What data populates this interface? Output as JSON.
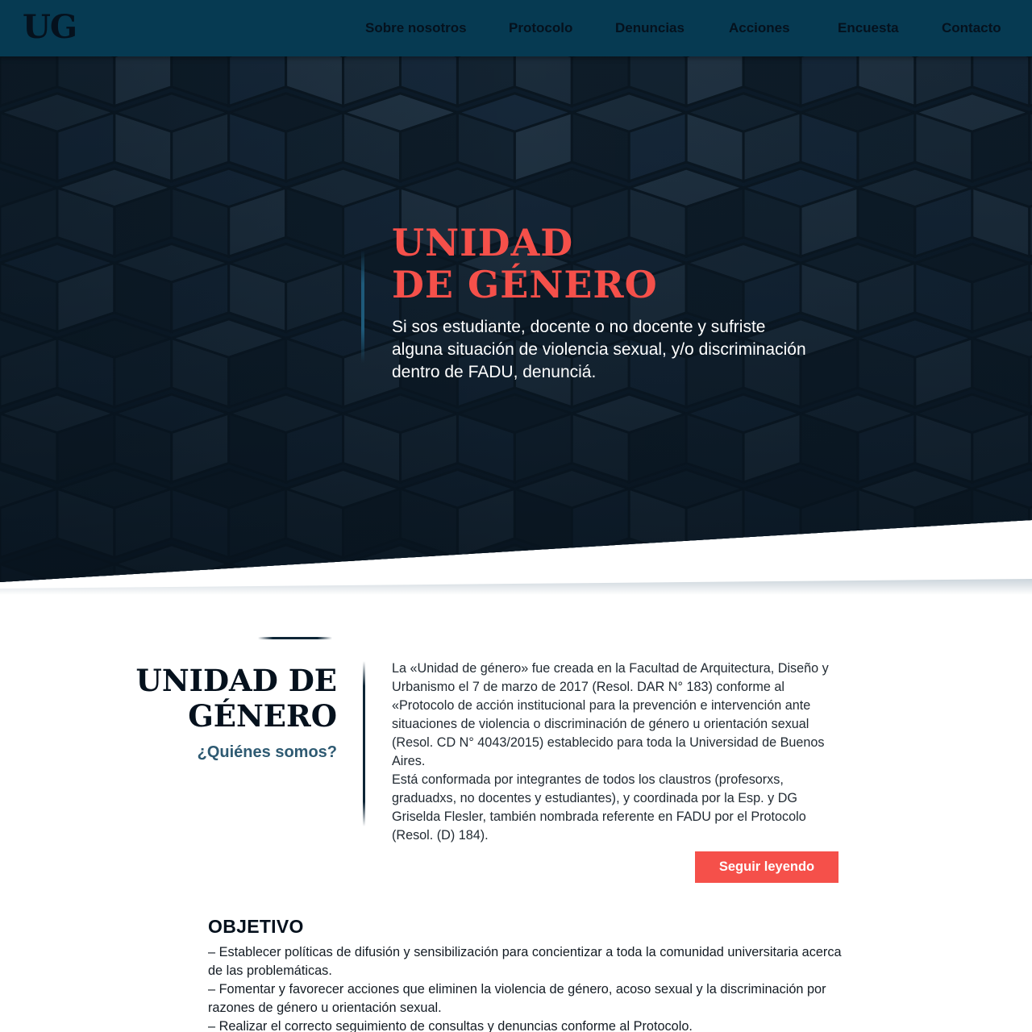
{
  "nav": {
    "logo": "UG",
    "links": [
      {
        "label": "Sobre nosotros"
      },
      {
        "label": "Protocolo"
      },
      {
        "label": "Denuncias"
      },
      {
        "label": "Acciones"
      },
      {
        "label": "Encuesta"
      },
      {
        "label": "Contacto"
      }
    ]
  },
  "hero": {
    "title_line1": "UNIDAD",
    "title_line2": "DE GÉNERO",
    "subtitle": "Si sos estudiante, docente o no docente y sufriste alguna situación de violencia sexual, y/o discriminación dentro de FADU, denunciá."
  },
  "about": {
    "title_line1": "UNIDAD DE",
    "title_line2": "GÉNERO",
    "subtitle": "¿Quiénes somos?",
    "paragraph1": "La «Unidad de género» fue creada en la Facultad de Arquitectura, Diseño y Urbanismo el 7 de marzo de 2017 (Resol. DAR N° 183) conforme al «Protocolo de acción institucional para la prevención e intervención ante situaciones de violencia o discriminación de género u orientación sexual  (Resol. CD N° 4043/2015) establecido para toda la Universidad de Buenos Aires.",
    "paragraph2": "Está conformada por integrantes de todos los claustros (profesorxs, graduadxs, no docentes y estudiantes), y coordinada por la Esp. y DG Griselda Flesler, también nombrada referente en FADU por el Protocolo (Resol. (D) 184).",
    "button_label": "Seguir leyendo"
  },
  "objective": {
    "title": "OBJETIVO",
    "items": [
      "– Establecer políticas de difusión y sensibilización para concientizar a toda la comunidad universitaria acerca de las problemáticas.",
      "– Fomentar y favorecer acciones que eliminen la violencia de género, acoso sexual y la discriminación por razones de género u orientación sexual.",
      "– Realizar el correcto seguimiento de consultas y denuncias conforme al Protocolo."
    ]
  },
  "colors": {
    "navbar": "#063a52",
    "hero_bg": "#0b1a28",
    "accent": "#f5504a",
    "subtitle_blue": "#2e5a72"
  }
}
